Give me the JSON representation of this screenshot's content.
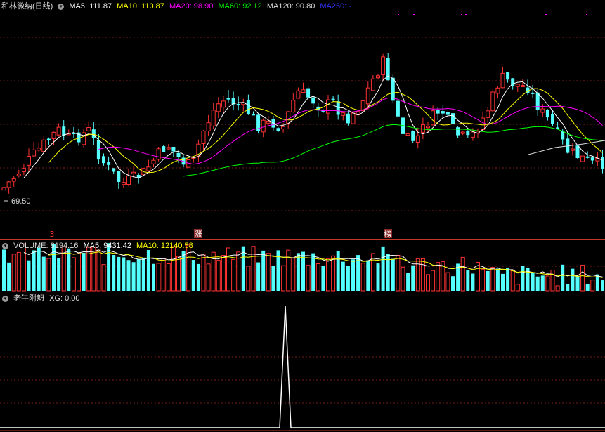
{
  "main": {
    "title": "和林微纳(日线)",
    "ma_labels": [
      {
        "text": "MA5: 111.87",
        "color": "#ffffff"
      },
      {
        "text": "MA10: 110.87",
        "color": "#ffff00"
      },
      {
        "text": "MA20: 98.90",
        "color": "#ff00ff"
      },
      {
        "text": "MA60: 92.12",
        "color": "#00ff00"
      },
      {
        "text": "MA120: 90.80",
        "color": "#dddddd"
      },
      {
        "text": "MA250: -",
        "color": "#3333ff"
      }
    ],
    "low_label": "69.50",
    "markers": [
      "3",
      "涨",
      "榜"
    ]
  },
  "volume": {
    "labels": [
      {
        "text": "VOLUME: 8194.16",
        "color": "#dddddd"
      },
      {
        "text": "MA5: 9431.42",
        "color": "#ffffff"
      },
      {
        "text": "MA10: 12140.58",
        "color": "#ffff00"
      }
    ]
  },
  "indicator": {
    "title": "老牛附魈",
    "xg_label": "XG: 0.00"
  },
  "colors": {
    "up": "#ff3232",
    "down": "#54ffff",
    "border": "#c0392b",
    "grid": "#7a1b1b"
  }
}
